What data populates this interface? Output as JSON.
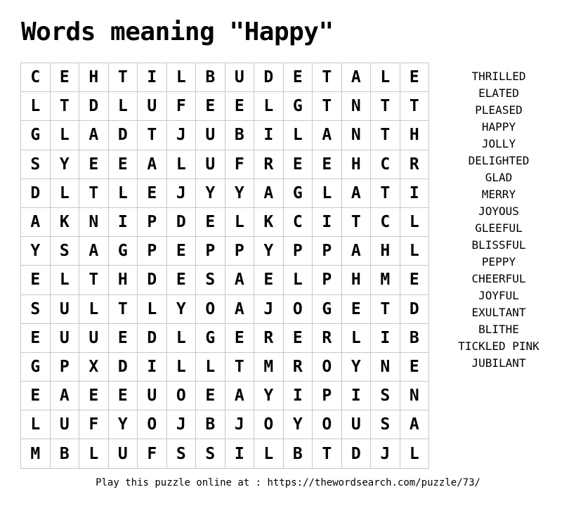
{
  "title": "Words meaning \"Happy\"",
  "grid": [
    [
      "C",
      "E",
      "H",
      "T",
      "I",
      "L",
      "B",
      "U",
      "D",
      "E",
      "T",
      "A",
      "L",
      "E"
    ],
    [
      "L",
      "T",
      "D",
      "L",
      "U",
      "F",
      "E",
      "E",
      "L",
      "G",
      "T",
      "N",
      "T",
      "T"
    ],
    [
      "G",
      "L",
      "A",
      "D",
      "T",
      "J",
      "U",
      "B",
      "I",
      "L",
      "A",
      "N",
      "T",
      "H"
    ],
    [
      "S",
      "Y",
      "E",
      "E",
      "A",
      "L",
      "U",
      "F",
      "R",
      "E",
      "E",
      "H",
      "C",
      "R"
    ],
    [
      "D",
      "L",
      "T",
      "L",
      "E",
      "J",
      "Y",
      "Y",
      "A",
      "G",
      "L",
      "A",
      "T",
      "I"
    ],
    [
      "A",
      "K",
      "N",
      "I",
      "P",
      "D",
      "E",
      "L",
      "K",
      "C",
      "I",
      "T",
      "C",
      "L"
    ],
    [
      "Y",
      "S",
      "A",
      "G",
      "P",
      "E",
      "P",
      "P",
      "Y",
      "P",
      "P",
      "A",
      "H",
      "L"
    ],
    [
      "E",
      "L",
      "T",
      "H",
      "D",
      "E",
      "S",
      "A",
      "E",
      "L",
      "P",
      "H",
      "M",
      "E"
    ],
    [
      "S",
      "U",
      "L",
      "T",
      "L",
      "Y",
      "O",
      "A",
      "J",
      "O",
      "G",
      "E",
      "T",
      "D"
    ],
    [
      "E",
      "U",
      "U",
      "E",
      "D",
      "L",
      "G",
      "E",
      "R",
      "E",
      "R",
      "L",
      "I",
      "B"
    ],
    [
      "G",
      "P",
      "X",
      "D",
      "I",
      "L",
      "L",
      "T",
      "M",
      "R",
      "O",
      "Y",
      "N",
      "E"
    ],
    [
      "E",
      "A",
      "E",
      "E",
      "U",
      "O",
      "E",
      "A",
      "Y",
      "I",
      "P",
      "I",
      "S",
      "N"
    ],
    [
      "L",
      "U",
      "F",
      "Y",
      "O",
      "J",
      "B",
      "J",
      "O",
      "Y",
      "O",
      "U",
      "S",
      "A"
    ],
    [
      "M",
      "B",
      "L",
      "U",
      "F",
      "S",
      "S",
      "I",
      "L",
      "B",
      "T",
      "D",
      "J",
      "L"
    ]
  ],
  "words": [
    "THRILLED",
    "ELATED",
    "PLEASED",
    "HAPPY",
    "JOLLY",
    "DELIGHTED",
    "GLAD",
    "MERRY",
    "JOYOUS",
    "GLEEFUL",
    "BLISSFUL",
    "PEPPY",
    "CHEERFUL",
    "JOYFUL",
    "EXULTANT",
    "BLITHE",
    "TICKLED PINK",
    "JUBILANT"
  ],
  "footer": "Play this puzzle online at : https://thewordsearch.com/puzzle/73/"
}
